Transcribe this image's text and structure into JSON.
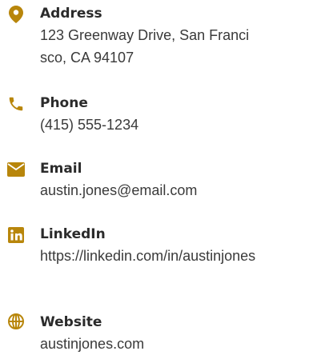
{
  "accent_color": "#b8860b",
  "contacts": [
    {
      "icon": "map-pin-icon",
      "label": "Address",
      "value": "123 Greenway Drive, San Francisco, CA 94107"
    },
    {
      "icon": "phone-icon",
      "label": "Phone",
      "value": "(415) 555-1234"
    },
    {
      "icon": "envelope-icon",
      "label": "Email",
      "value": "austin.jones@email.com"
    },
    {
      "icon": "linkedin-icon",
      "label": "LinkedIn",
      "value": "https://linkedin.com/in/austinjones"
    },
    {
      "icon": "globe-icon",
      "label": "Website",
      "value": "austinjones.com"
    }
  ]
}
